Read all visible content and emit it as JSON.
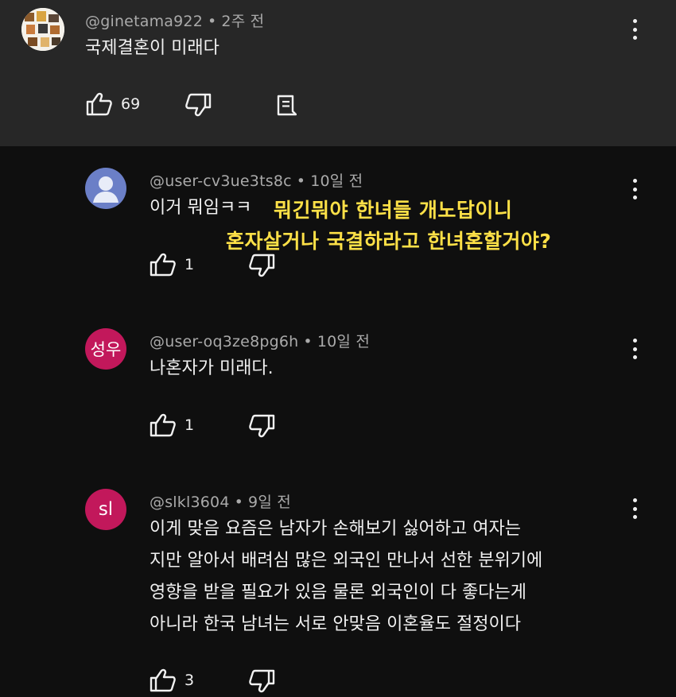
{
  "comments": [
    {
      "author": "@ginetama922",
      "time": "2주 전",
      "lines": [
        "국제결혼이 미래다"
      ],
      "likes": "69"
    },
    {
      "author": "@user-cv3ue3ts8c",
      "time": "10일 전",
      "lines": [
        "이거 뭐임ㅋㅋ"
      ],
      "likes": "1",
      "overlay": [
        "뭐긴뭐야 한녀들 개노답이니",
        "혼자살거나 국결하라고 한녀혼할거야?"
      ]
    },
    {
      "author": "@user-oq3ze8pg6h",
      "time": "10일 전",
      "avatar_text": "성우",
      "lines": [
        "나혼자가 미래다."
      ],
      "likes": "1"
    },
    {
      "author": "@slkl3604",
      "time": "9일 전",
      "avatar_text": "sl",
      "lines": [
        "이게 맞음 요즘은 남자가 손해보기 싫어하고 여자는",
        "지만 알아서 배려심 많은 외국인 만나서 선한 분위기에",
        "영향을 받을 필요가 있음 물론 외국인이 다 좋다는게",
        "아니라 한국 남녀는 서로 안맞음 이혼율도 절정이다"
      ],
      "likes": "3"
    }
  ],
  "colors": {
    "parent_bg": "#272727",
    "reply_bg": "#0f0f0f",
    "meta": "#aaaaaa",
    "avatar_pink": "#c2185b",
    "avatar_default": "#6b7fc7",
    "highlight": "#fde047"
  },
  "icons": [
    "like-icon",
    "dislike-icon",
    "reply-icon",
    "more-options-icon",
    "default-avatar-icon"
  ]
}
